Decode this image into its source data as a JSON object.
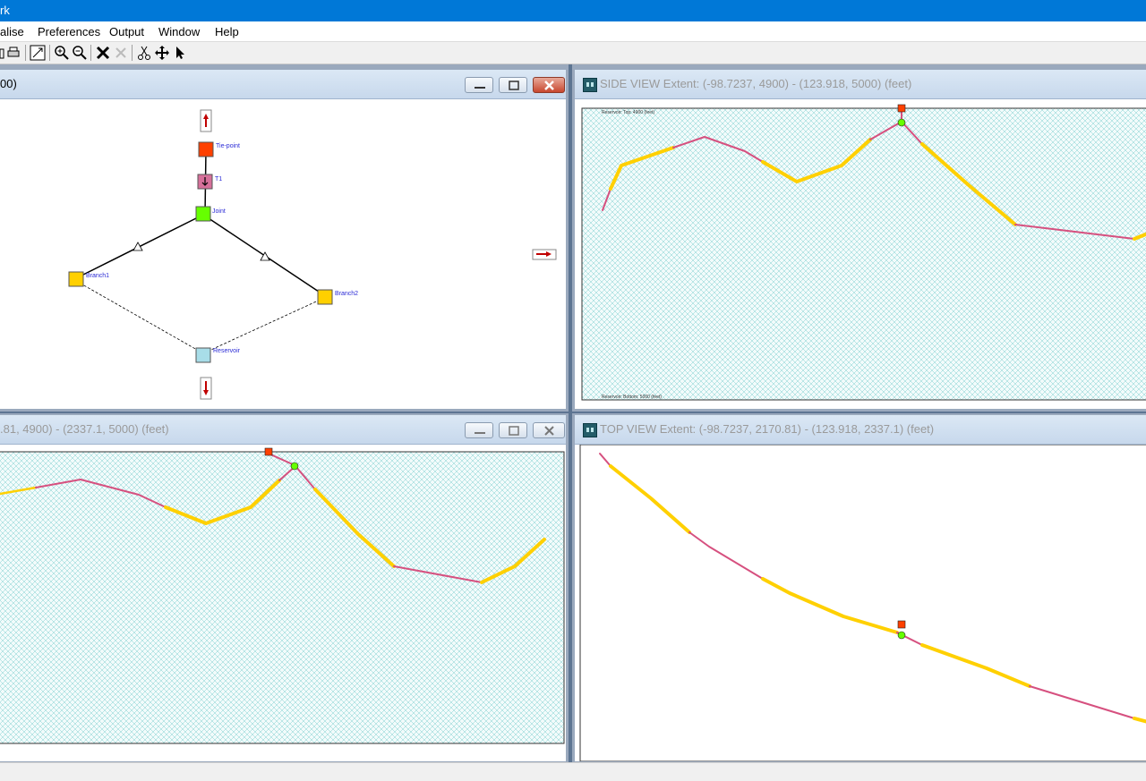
{
  "app": {
    "title": "rk"
  },
  "menu": [
    "alise",
    "Preferences",
    "Output",
    "Window",
    "Help"
  ],
  "toolbar": {
    "icons": [
      "open-icon",
      "print-icon",
      "resize-icon",
      "zoom-in-icon",
      "zoom-out-icon",
      "delete-icon",
      "delete-disabled-icon",
      "cut-icon",
      "move-icon",
      "pointer-icon"
    ]
  },
  "windows": {
    "network": {
      "title": "00)"
    },
    "side_view": {
      "title": "SIDE VIEW Extent: (-98.7237, 4900) - (123.918, 5000) (feet)",
      "reservoir_top": "Reservoir: Top: 4900 (feet)",
      "reservoir_bottom": "Reservoir: Bottom: 5000 (feet)"
    },
    "section_view": {
      "title": ".81, 4900) - (2337.1, 5000) (feet)"
    },
    "top_view": {
      "title": "TOP VIEW Extent: (-98.7237, 2170.81) - (123.918, 2337.1) (feet)"
    }
  },
  "network_nodes": {
    "tie_point": "Tie-point",
    "t1": "T1",
    "joint": "Joint",
    "branch1": "Branch1",
    "branch2": "Branch2",
    "reservoir": "Reservoir"
  },
  "colors": {
    "well_yellow": "#ffd000",
    "well_pink": "#d6507f",
    "tie_red": "#ff4000",
    "joint_green": "#66ff00",
    "hatch": "#7fcfcf"
  }
}
